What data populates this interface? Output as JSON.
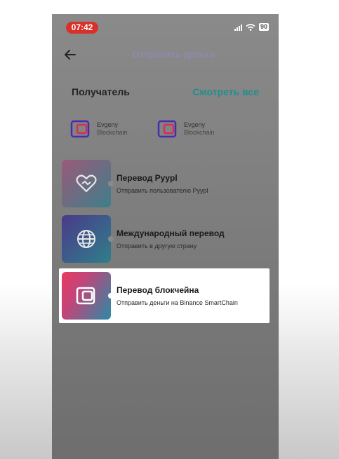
{
  "status_bar": {
    "time": "07:42",
    "battery": "90"
  },
  "header": {
    "title": "Отправить деньги"
  },
  "recipients": {
    "label": "Получатель",
    "see_all": "Смотреть все",
    "contacts": [
      {
        "name": "Evgeny",
        "network": "Blockchain"
      },
      {
        "name": "Evgeny",
        "network": "Blockchain"
      }
    ]
  },
  "transfers": [
    {
      "title": "Перевод Pyypl",
      "subtitle": "Отправить пользователю Pyypl",
      "icon": "heart-icon"
    },
    {
      "title": "Международный перевод",
      "subtitle": "Отправить в другую страну",
      "icon": "globe-icon"
    },
    {
      "title": "Перевод блокчейна",
      "subtitle": "Отправить деньги на Binance SmartChain",
      "icon": "wallet-icon"
    }
  ],
  "colors": {
    "status_time_bg": "#d93028",
    "see_all": "#1f8f8a",
    "header_title": "#8c8ab0",
    "overlay": "#8a8a8a"
  }
}
